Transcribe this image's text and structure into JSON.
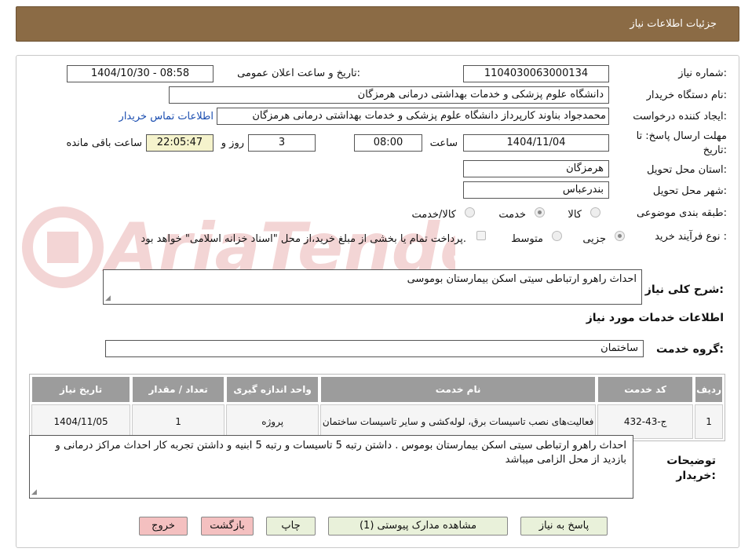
{
  "header": {
    "title": "جزئیات اطلاعات نیاز"
  },
  "form": {
    "need_number_label": "شماره نیاز:",
    "need_number": "1104030063000134",
    "announce_label": "تاریخ و ساعت اعلان عمومی:",
    "announce_value": "1404/10/30 - 08:58",
    "buyer_org_label": "نام دستگاه خریدار:",
    "buyer_org": "دانشگاه علوم پزشکی و خدمات بهداشتی درمانی هرمزگان",
    "requester_label": "ایجاد کننده درخواست:",
    "requester": "محمدجواد بناوند کارپرداز دانشگاه علوم پزشکی و خدمات بهداشتی درمانی هرمزگان",
    "contact_link": "اطلاعات تماس خریدار",
    "deadline_label_1": "مهلت ارسال پاسخ: تا",
    "deadline_label_2": "تاریخ:",
    "deadline_date": "1404/11/04",
    "time_label": "ساعت",
    "deadline_time": "08:00",
    "days_value": "3",
    "days_label": "روز و",
    "remaining_time": "22:05:47",
    "remaining_label": "ساعت باقی مانده",
    "province_label": "استان محل تحویل:",
    "province": "هرمزگان",
    "city_label": "شهر محل تحویل:",
    "city": "بندرعباس",
    "category_label": "طبقه بندی موضوعی:",
    "category_options": [
      "کالا",
      "خدمت",
      "کالا/خدمت"
    ],
    "category_selected": "خدمت",
    "process_label": "نوع فرآیند خرید :",
    "process_options": [
      "جزیی",
      "متوسط"
    ],
    "process_selected": "جزیی",
    "payment_note": "پرداخت تمام یا بخشی از مبلغ خرید،از محل \"اسناد خزانه اسلامی\" خواهد بود.",
    "summary_label": "شرح کلی نیاز:",
    "summary": "احداث راهرو  ارتباطی سیتی اسکن  بیمارستان بوموسی",
    "services_title": "اطلاعات خدمات مورد نیاز",
    "service_group_label": "گروه خدمت:",
    "service_group": "ساختمان",
    "buyer_notes_label_1": "توضیحات",
    "buyer_notes_label_2": "خریدار:",
    "buyer_notes": "احداث راهرو ارتباطی سیتی اسکن  بیمارستان بوموس . داشتن  رتبه 5 تاسیسات و رتبه 5 ابنیه و داشتن تجربه کار احداث مراکز درمانی  و بازدید از محل  الزامی میباشد"
  },
  "table": {
    "headers": [
      "ردیف",
      "کد خدمت",
      "نام خدمت",
      "واحد اندازه گیری",
      "تعداد / مقدار",
      "تاریخ نیاز"
    ],
    "rows": [
      [
        "1",
        "ج-43-432",
        "فعالیت‌های نصب تاسیسات برق، لوله‌کشی و سایر تاسیسات ساختمان",
        "پروژه",
        "1",
        "1404/11/05"
      ]
    ]
  },
  "buttons": {
    "reply": "پاسخ به نیاز",
    "attachments": "مشاهده مدارک پیوستی (1)",
    "print": "چاپ",
    "back": "بازگشت",
    "exit": "خروج"
  },
  "colors": {
    "header_bg": "#8b6b45",
    "button_green": "#e9f1da",
    "button_red": "#f4c0c0",
    "table_header": "#9c9c9c"
  },
  "watermark_logo_text": "AriaTender.neT"
}
